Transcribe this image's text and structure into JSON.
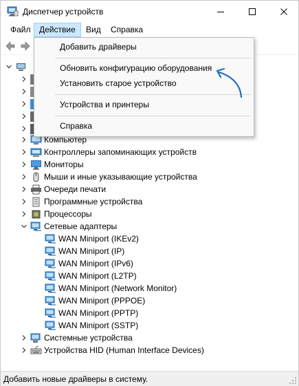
{
  "window": {
    "title": "Диспетчер устройств",
    "icon": "device-manager-icon"
  },
  "menubar": {
    "items": [
      {
        "label": "Файл"
      },
      {
        "label": "Действие",
        "active": true
      },
      {
        "label": "Вид"
      },
      {
        "label": "Справка"
      }
    ]
  },
  "toolbar": {
    "buttons": [
      "back-arrow-icon",
      "forward-arrow-icon"
    ]
  },
  "action_menu": {
    "items": [
      {
        "label": "Добавить драйверы"
      },
      {
        "label": "Обновить конфигурацию оборудования"
      },
      {
        "label": "Установить старое устройство"
      },
      {
        "label": "Устройства и принтеры"
      },
      {
        "label": "Справка"
      }
    ]
  },
  "tree": {
    "root_hidden_rows": 6,
    "rows": [
      {
        "label": "Компьютер",
        "icon": "computer-icon",
        "expanded": false
      },
      {
        "label": "Контроллеры запоминающих устройств",
        "icon": "storage-controller-icon",
        "expanded": false
      },
      {
        "label": "Мониторы",
        "icon": "monitor-icon",
        "expanded": false
      },
      {
        "label": "Мыши и иные указывающие устройства",
        "icon": "mouse-icon",
        "expanded": false
      },
      {
        "label": "Очереди печати",
        "icon": "printer-icon",
        "expanded": false
      },
      {
        "label": "Программные устройства",
        "icon": "software-device-icon",
        "expanded": false
      },
      {
        "label": "Процессоры",
        "icon": "processor-icon",
        "expanded": false
      },
      {
        "label": "Сетевые адаптеры",
        "icon": "network-adapter-icon",
        "expanded": true
      },
      {
        "label": "WAN Miniport (IKEv2)",
        "icon": "network-adapter-icon",
        "child": true
      },
      {
        "label": "WAN Miniport (IP)",
        "icon": "network-adapter-icon",
        "child": true
      },
      {
        "label": "WAN Miniport (IPv6)",
        "icon": "network-adapter-icon",
        "child": true
      },
      {
        "label": "WAN Miniport (L2TP)",
        "icon": "network-adapter-icon",
        "child": true
      },
      {
        "label": "WAN Miniport (Network Monitor)",
        "icon": "network-adapter-icon",
        "child": true
      },
      {
        "label": "WAN Miniport (PPPOE)",
        "icon": "network-adapter-icon",
        "child": true
      },
      {
        "label": "WAN Miniport (PPTP)",
        "icon": "network-adapter-icon",
        "child": true
      },
      {
        "label": "WAN Miniport (SSTP)",
        "icon": "network-adapter-icon",
        "child": true
      },
      {
        "label": "Системные устройства",
        "icon": "system-device-icon",
        "expanded": false
      },
      {
        "label": "Устройства HID (Human Interface Devices)",
        "icon": "hid-icon",
        "expanded": false
      }
    ]
  },
  "statusbar": {
    "text": "Добавить новые драйверы в систему."
  },
  "colors": {
    "menu_highlight": "#cce8ff",
    "annotation_arrow": "#1e6fb8",
    "network_icon": "#3b8ed8"
  }
}
